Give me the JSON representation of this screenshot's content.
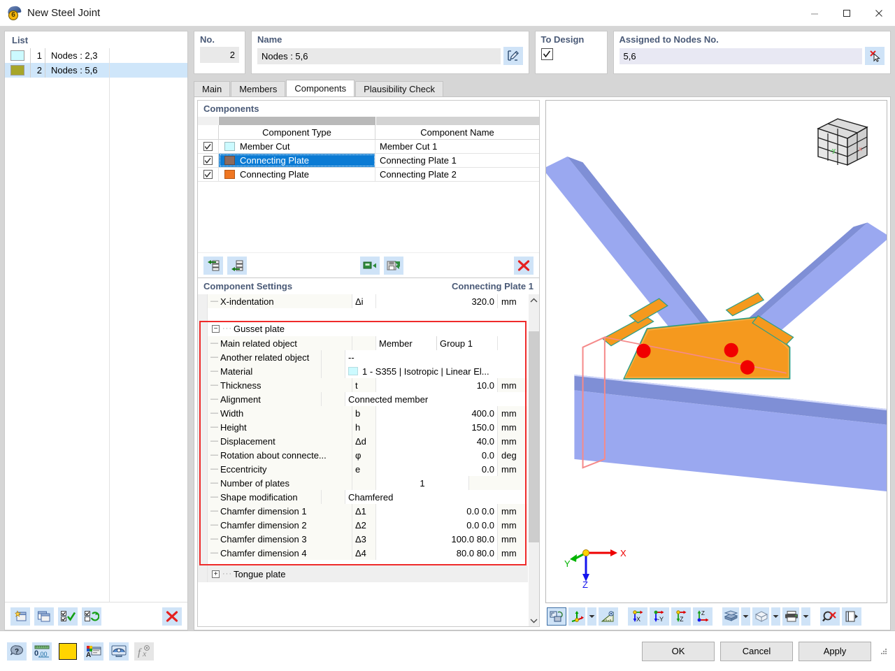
{
  "window": {
    "title": "New Steel Joint",
    "minimize": "–",
    "maximize": "□",
    "close": "×"
  },
  "list": {
    "title": "List",
    "items": [
      {
        "color": "#ccfaff",
        "num": "1",
        "label": "Nodes : 2,3",
        "selected": false
      },
      {
        "color": "#a7a62a",
        "num": "2",
        "label": "Nodes : 5,6",
        "selected": true
      }
    ],
    "toolbar": [
      {
        "name": "new-joint-button",
        "icon": "new-window-icon"
      },
      {
        "name": "copy-joint-button",
        "icon": "copy-window-icon"
      },
      {
        "name": "select-all-button",
        "icon": "check-all-icon"
      },
      {
        "name": "invert-selection-button",
        "icon": "invert-check-icon"
      },
      {
        "name": "delete-joint-button",
        "icon": "red-x-icon"
      }
    ]
  },
  "fields": {
    "no_label": "No.",
    "no_value": "2",
    "name_label": "Name",
    "name_value": "Nodes : 5,6",
    "name_edit_icon": "edit-pencil-icon",
    "to_design_label": "To Design",
    "to_design_checked": true,
    "assigned_label": "Assigned to Nodes No.",
    "assigned_value": "5,6",
    "assigned_pick_icon": "pick-cursor-icon"
  },
  "tabs": [
    {
      "label": "Main",
      "active": false
    },
    {
      "label": "Members",
      "active": false
    },
    {
      "label": "Components",
      "active": true
    },
    {
      "label": "Plausibility Check",
      "active": false
    }
  ],
  "components_panel": {
    "title": "Components",
    "columns": [
      "",
      "Component Type",
      "Component Name"
    ],
    "rows": [
      {
        "checked": true,
        "color": "#ccfaff",
        "type": "Member Cut",
        "name": "Member Cut 1",
        "selected": false
      },
      {
        "checked": true,
        "color": "#8c6a5d",
        "type": "Connecting Plate",
        "name": "Connecting Plate 1",
        "selected": true
      },
      {
        "checked": true,
        "color": "#ef7622",
        "type": "Connecting Plate",
        "name": "Connecting Plate 2",
        "selected": false
      }
    ],
    "toolbar": [
      {
        "name": "move-up-button",
        "icon": "arrow-left-stack-icon"
      },
      {
        "name": "move-down-button",
        "icon": "arrow-left-stack-down-icon"
      },
      {
        "name": "import-component-button",
        "icon": "green-import-icon"
      },
      {
        "name": "save-component-button",
        "icon": "green-save-icon"
      },
      {
        "name": "delete-component-button",
        "icon": "red-x-icon"
      }
    ]
  },
  "settings_panel": {
    "title": "Component Settings",
    "subject": "Connecting Plate 1",
    "pre_rows": [
      {
        "name": "X-indentation",
        "symbol": "Δi",
        "value": "320.0",
        "unit": "mm",
        "indent": 2,
        "kind": "num"
      }
    ],
    "section": {
      "label": "Gusset plate",
      "expanded": true,
      "highlight_color": "#ef2b2b",
      "rows": [
        {
          "name": "Main related object",
          "symbol": "",
          "value": "Member",
          "value2": "Group 1",
          "unit": "",
          "kind": "split"
        },
        {
          "name": "Another related object",
          "symbol": "",
          "value": "--",
          "unit": "",
          "kind": "text"
        },
        {
          "name": "Material",
          "symbol": "",
          "value": "1 - S355 | Isotropic | Linear El...",
          "unit": "",
          "kind": "material",
          "swatch": "#ccfaff"
        },
        {
          "name": "Thickness",
          "symbol": "t",
          "value": "10.0",
          "unit": "mm",
          "kind": "num"
        },
        {
          "name": "Alignment",
          "symbol": "",
          "value": "Connected member",
          "unit": "",
          "kind": "text"
        },
        {
          "name": "Width",
          "symbol": "b",
          "value": "400.0",
          "unit": "mm",
          "kind": "num"
        },
        {
          "name": "Height",
          "symbol": "h",
          "value": "150.0",
          "unit": "mm",
          "kind": "num"
        },
        {
          "name": "Displacement",
          "symbol": "Δd",
          "value": "40.0",
          "unit": "mm",
          "kind": "num"
        },
        {
          "name": "Rotation about connecte...",
          "symbol": "φ",
          "value": "0.0",
          "unit": "deg",
          "kind": "num"
        },
        {
          "name": "Eccentricity",
          "symbol": "e",
          "value": "0.0",
          "unit": "mm",
          "kind": "num"
        },
        {
          "name": "Number of plates",
          "symbol": "",
          "value": "1",
          "unit": "",
          "kind": "center"
        },
        {
          "name": "Shape modification",
          "symbol": "",
          "value": "Chamfered",
          "unit": "",
          "kind": "text"
        },
        {
          "name": "Chamfer dimension 1",
          "symbol": "Δ1",
          "value": "0.0 0.0",
          "unit": "mm",
          "kind": "num"
        },
        {
          "name": "Chamfer dimension 2",
          "symbol": "Δ2",
          "value": "0.0 0.0",
          "unit": "mm",
          "kind": "num"
        },
        {
          "name": "Chamfer dimension 3",
          "symbol": "Δ3",
          "value": "100.0 80.0",
          "unit": "mm",
          "kind": "num"
        },
        {
          "name": "Chamfer dimension 4",
          "symbol": "Δ4",
          "value": "80.0 80.0",
          "unit": "mm",
          "kind": "num"
        }
      ]
    },
    "post_rows": [
      {
        "name": "Tongue plate",
        "expanded": false,
        "kind": "section"
      }
    ],
    "scroll_up_icon": "chevron-up-icon",
    "scroll_down_icon": "chevron-down-icon"
  },
  "viewport": {
    "nav_cube_labels": {
      "y": "-y",
      "x": "x"
    },
    "axes": {
      "x": "X",
      "y": "Y",
      "z": "Z"
    },
    "colors": {
      "member": "#9aa8f0",
      "member_shade": "#7f8fd6",
      "plate": "#f5991e",
      "bolt": "#f10000",
      "outline_pink": "#f58a8a",
      "outline_teal": "#2e9e86"
    },
    "toolbar": [
      {
        "name": "render-mode-button",
        "icon": "render-toggle-icon",
        "selected": true
      },
      {
        "name": "coordinate-system-button",
        "icon": "axes-icon",
        "dropdown": true
      },
      {
        "name": "measure-button",
        "icon": "ruler-icon"
      },
      {
        "name": "view-x-button",
        "icon": "view-x-icon"
      },
      {
        "name": "view-minus-y-button",
        "icon": "view-minus-y-icon"
      },
      {
        "name": "view-z-button",
        "icon": "view-z-icon"
      },
      {
        "name": "view-isometric-button",
        "icon": "view-iso-icon"
      },
      {
        "name": "display-style-button",
        "icon": "solid-blocks-icon",
        "dropdown": true
      },
      {
        "name": "wireframe-button",
        "icon": "wire-cube-icon",
        "dropdown": true
      },
      {
        "name": "print-button",
        "icon": "printer-icon",
        "dropdown": true
      },
      {
        "name": "clear-selection-button",
        "icon": "magnifier-x-icon"
      },
      {
        "name": "panel-toggle-button",
        "icon": "panel-arrow-icon"
      }
    ]
  },
  "statusbar": {
    "buttons": [
      {
        "name": "help-button",
        "icon": "question-balloon-icon"
      },
      {
        "name": "units-button",
        "icon": "units-000-icon"
      },
      {
        "name": "color-button",
        "icon": "yellow-swatch-icon"
      },
      {
        "name": "display-properties-button",
        "icon": "colors-window-icon"
      },
      {
        "name": "visibility-button",
        "icon": "monitor-icon"
      },
      {
        "name": "formula-button",
        "icon": "fx-icon",
        "disabled": true
      }
    ]
  },
  "footer": {
    "ok": "OK",
    "cancel": "Cancel",
    "apply": "Apply"
  }
}
